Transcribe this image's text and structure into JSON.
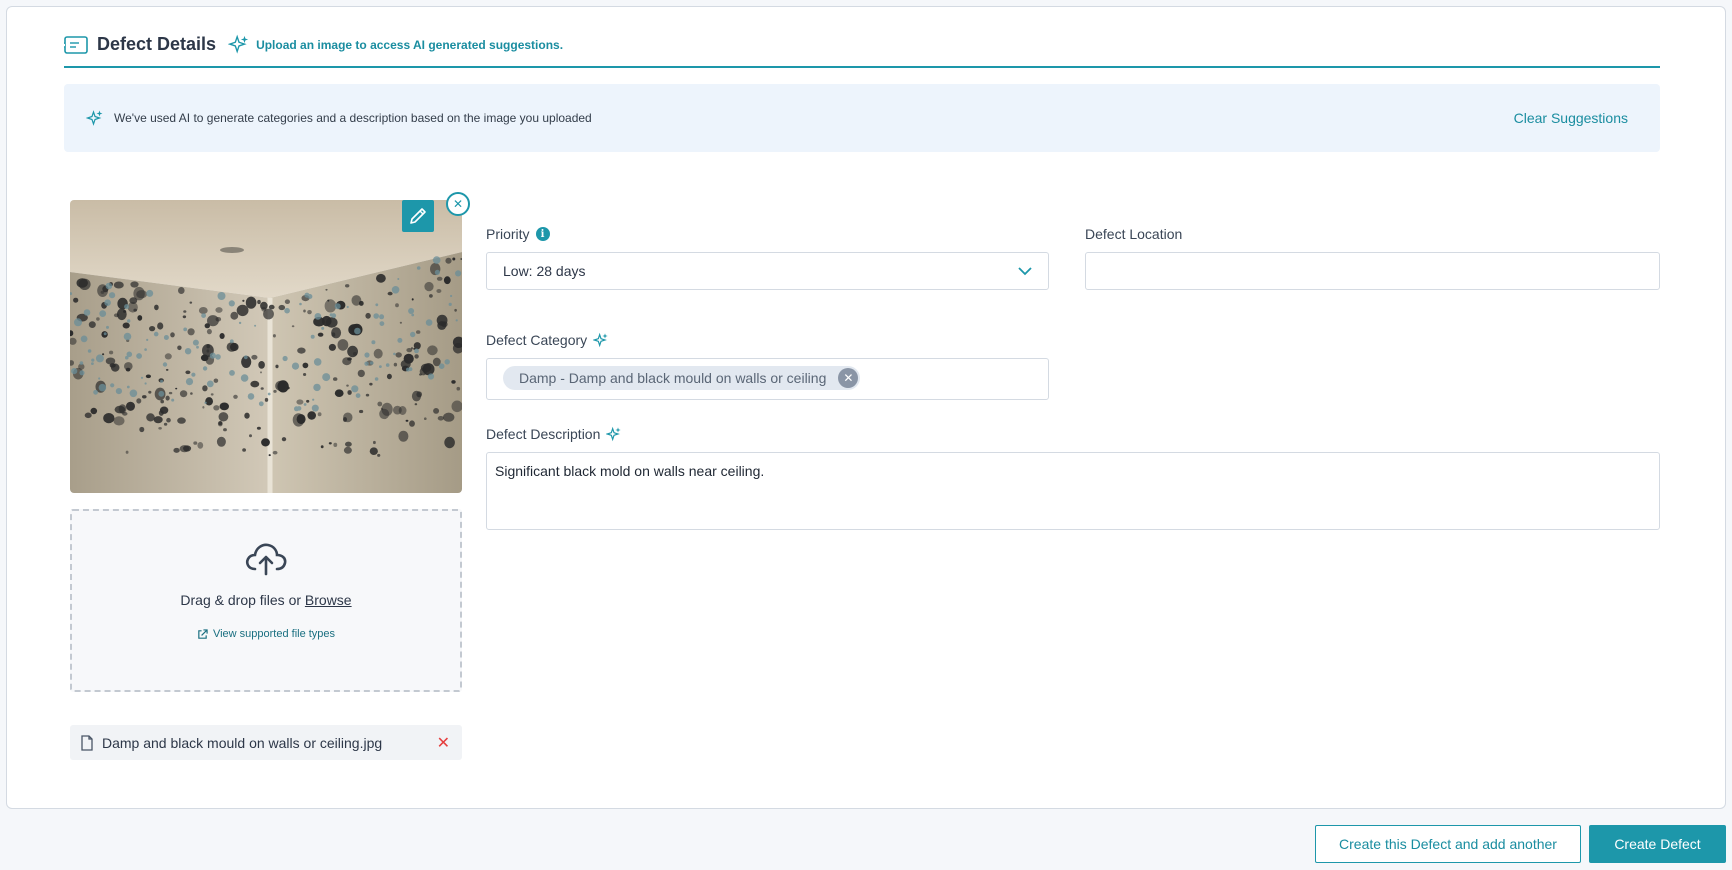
{
  "header": {
    "title": "Defect Details",
    "ai_hint": "Upload an image to access AI generated suggestions.",
    "icon": "ticket-icon"
  },
  "banner": {
    "message": "We've used AI to generate categories and a description based on the image you uploaded",
    "clear_label": "Clear Suggestions",
    "icon": "sparkle-icon"
  },
  "image": {
    "alt": "Damp and black mould on walls or ceiling",
    "edit_icon": "pencil-icon",
    "remove_icon": "close-icon"
  },
  "dropzone": {
    "text": "Drag & drop files or",
    "browse_label": "Browse",
    "types_label": "View supported file types",
    "icon": "cloud-upload-icon"
  },
  "file": {
    "name": "Damp and black mould on walls or ceiling.jpg",
    "remove_icon": "close-icon"
  },
  "form": {
    "priority": {
      "label": "Priority",
      "value": "Low: 28 days"
    },
    "location": {
      "label": "Defect Location",
      "value": ""
    },
    "category": {
      "label": "Defect Category",
      "chip": "Damp - Damp and black mould on walls or ceiling"
    },
    "description": {
      "label": "Defect Description",
      "value": "Significant black mold on walls near ceiling."
    }
  },
  "actions": {
    "secondary_label": "Create this Defect and add another",
    "primary_label": "Create Defect"
  },
  "colors": {
    "accent": "#1d97aa",
    "banner_bg": "#edf4fc",
    "danger": "#e53e3e"
  }
}
